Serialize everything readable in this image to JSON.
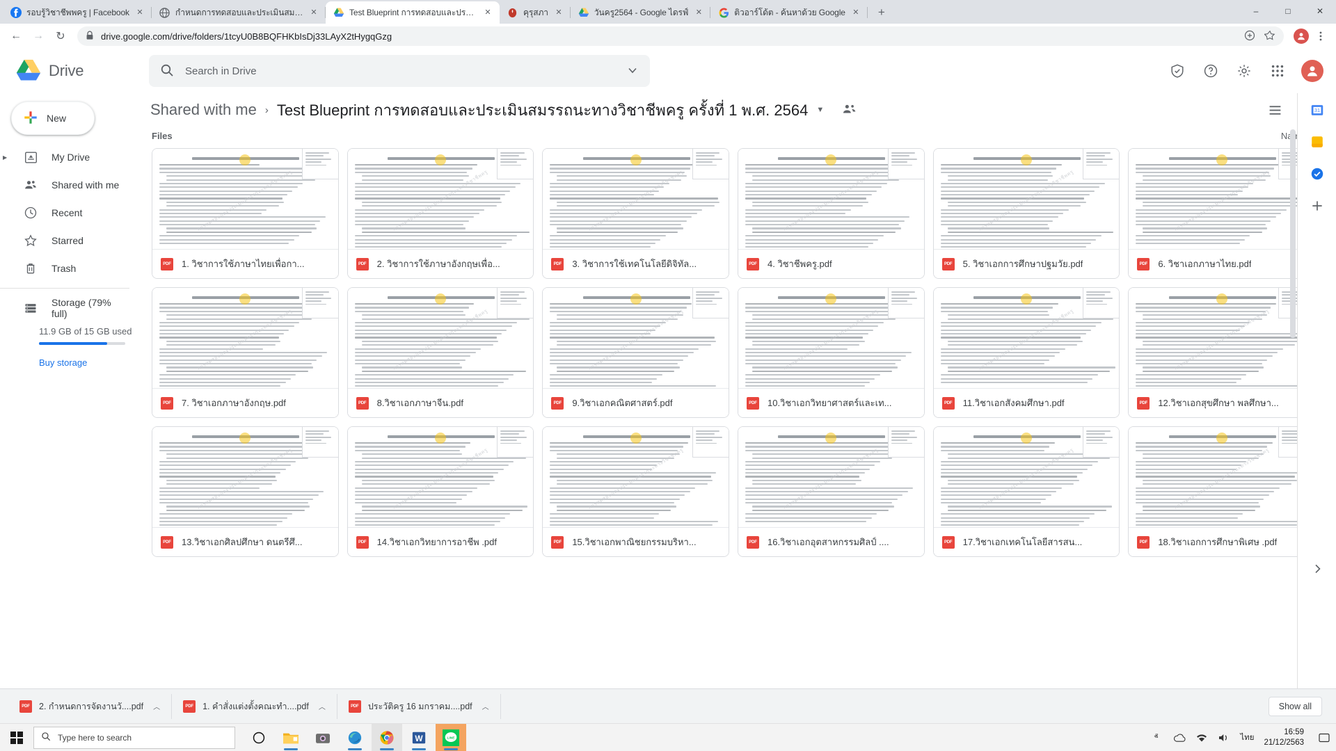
{
  "browser": {
    "tabs": [
      {
        "title": "รอบรู้วิชาชีพพครู | Facebook",
        "icon": "facebook-icon",
        "active": false
      },
      {
        "title": "กำหนดการทดสอบและประเมินสมรรถน",
        "icon": "globe-icon",
        "active": false
      },
      {
        "title": "Test Blueprint การทดสอบและประเมิ",
        "icon": "drive-icon",
        "active": true
      },
      {
        "title": "คุรุสภา",
        "icon": "ksp-icon",
        "active": false
      },
      {
        "title": "วันครู2564 - Google ไดรฟ์",
        "icon": "drive-icon",
        "active": false
      },
      {
        "title": "ติวอาร์โด้ต - ค้นหาด้วย Google",
        "icon": "google-icon",
        "active": false
      }
    ],
    "new_tab_label": "+",
    "window_controls": {
      "minimize": "–",
      "maximize": "□",
      "close": "✕"
    },
    "url": "drive.google.com/drive/folders/1tcyU0B8BQFHKbIsDj33LAyX2tHygqGzg",
    "nav": {
      "back": "←",
      "forward": "→",
      "reload": "↻"
    },
    "profile_initial": ""
  },
  "drive": {
    "brand": "Drive",
    "search_placeholder": "Search in Drive",
    "search_value": "",
    "header_icons": [
      "support-icon",
      "help-icon",
      "settings-icon",
      "apps-grid-icon",
      "account-avatar"
    ],
    "breadcrumb": {
      "root": "Shared with me",
      "separator": "›",
      "current": "Test Blueprint การทดสอบและประเมินสมรรถนะทางวิชาชีพครู ครั้งที่ 1 พ.ศ. 2564"
    },
    "files_label": "Files",
    "sort": {
      "label": "Name",
      "direction": "↑"
    },
    "view_icons": [
      "list-view-icon",
      "details-info-icon"
    ],
    "sidebar": {
      "new_label": "New",
      "items": [
        {
          "label": "My Drive",
          "icon": "my-drive-icon",
          "expandable": true
        },
        {
          "label": "Shared with me",
          "icon": "shared-with-me-icon",
          "expandable": false
        },
        {
          "label": "Recent",
          "icon": "recent-clock-icon",
          "expandable": false
        },
        {
          "label": "Starred",
          "icon": "star-icon",
          "expandable": false
        },
        {
          "label": "Trash",
          "icon": "trash-icon",
          "expandable": false
        }
      ],
      "storage": {
        "title": "Storage (79% full)",
        "used_text": "11.9 GB of 15 GB used",
        "percent": 79,
        "buy_label": "Buy storage",
        "bar_color": "#1a73e8"
      }
    },
    "files": [
      {
        "name": "1. วิชาการใช้ภาษาไทยเพื่อกา...",
        "type": "pdf"
      },
      {
        "name": "2. วิชาการใช้ภาษาอังกฤษเพื่อ...",
        "type": "pdf"
      },
      {
        "name": "3. วิชาการใช้เทคโนโลยีดิจิทัล...",
        "type": "pdf"
      },
      {
        "name": "4. วิชาชีพครู.pdf",
        "type": "pdf"
      },
      {
        "name": "5. วิชาเอกการศึกษาปฐมวัย.pdf",
        "type": "pdf"
      },
      {
        "name": "6. วิชาเอกภาษาไทย.pdf",
        "type": "pdf"
      },
      {
        "name": "7. วิชาเอกภาษาอังกฤษ.pdf",
        "type": "pdf"
      },
      {
        "name": "8.วิชาเอกภาษาจีน.pdf",
        "type": "pdf"
      },
      {
        "name": "9.วิชาเอกคณิตศาสตร์.pdf",
        "type": "pdf"
      },
      {
        "name": "10.วิชาเอกวิทยาศาสตร์และเท...",
        "type": "pdf"
      },
      {
        "name": "11.วิชาเอกสังคมศึกษา.pdf",
        "type": "pdf"
      },
      {
        "name": "12.วิชาเอกสุขศึกษา พลศึกษา...",
        "type": "pdf"
      },
      {
        "name": "13.วิชาเอกศิลปศึกษา ดนตรีศึ...",
        "type": "pdf"
      },
      {
        "name": "14.วิชาเอกวิทยาการอาชีพ .pdf",
        "type": "pdf"
      },
      {
        "name": "15.วิชาเอกพาณิชยกรรมบริหา...",
        "type": "pdf"
      },
      {
        "name": "16.วิชาเอกอุตสาหกรรมศิลป์ ....",
        "type": "pdf"
      },
      {
        "name": "17.วิชาเอกเทคโนโลยีสารสน...",
        "type": "pdf"
      },
      {
        "name": "18.วิชาเอกการศึกษาพิเศษ .pdf",
        "type": "pdf"
      }
    ],
    "watermark_text": "การทดสอบและประเมินสมรรถนะทางวิชาชีพครู"
  },
  "downloads": {
    "items": [
      {
        "name": "2. กำหนดการจัดงานวั....pdf",
        "caret": "ⱏ"
      },
      {
        "name": "1. คำสั่งแต่งตั้งคณะทำ....pdf",
        "caret": "ⱏ"
      },
      {
        "name": "ประวัติครู 16 มกราคม....pdf",
        "caret": "ⱏ"
      }
    ],
    "show_all": "Show all"
  },
  "taskbar": {
    "search_placeholder": "Type here to search",
    "apps": [
      "cortana-icon",
      "file-explorer-icon",
      "camera-icon",
      "edge-icon",
      "chrome-icon",
      "word-icon",
      "line-icon"
    ],
    "tray": {
      "up_arrow": "ⱏ",
      "onedrive": "onedrive-icon",
      "network": "network-icon",
      "volume": "volume-icon",
      "language": "ไทย"
    },
    "clock_time": "16:59",
    "clock_date": "21/12/2563"
  }
}
